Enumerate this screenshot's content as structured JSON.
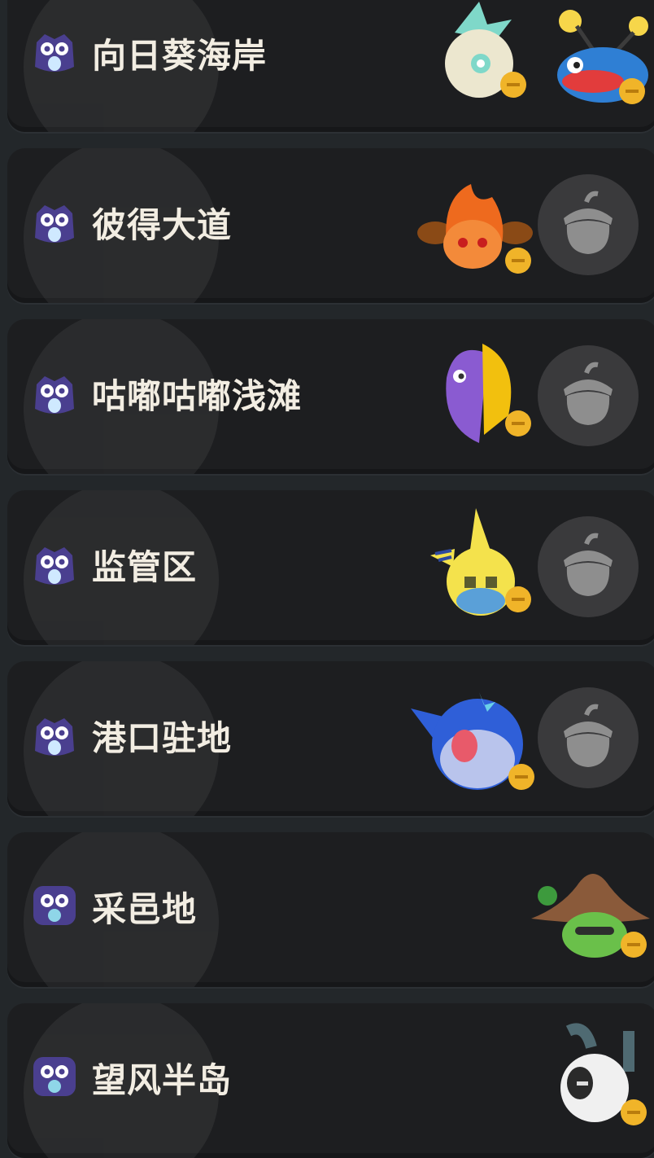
{
  "regions": [
    {
      "name": "向日葵海岸",
      "owl_style": "solid",
      "creatures": [
        "crested-shell-creature-icon",
        "antenna-fish-creature-icon"
      ],
      "locked_slot": false
    },
    {
      "name": "彼得大道",
      "owl_style": "solid",
      "creatures": [
        "flame-ram-creature-icon"
      ],
      "locked_slot": true
    },
    {
      "name": "咕嘟咕嘟浅滩",
      "owl_style": "solid",
      "creatures": [
        "toucan-creature-icon"
      ],
      "locked_slot": true
    },
    {
      "name": "监管区",
      "owl_style": "solid",
      "creatures": [
        "horned-yellow-creature-icon"
      ],
      "locked_slot": true
    },
    {
      "name": "港口驻地",
      "owl_style": "solid",
      "creatures": [
        "blue-bird-creature-icon"
      ],
      "locked_slot": true
    },
    {
      "name": "采邑地",
      "owl_style": "framed",
      "creatures": [
        "hat-frog-creature-icon"
      ],
      "locked_slot": false
    },
    {
      "name": "望风半岛",
      "owl_style": "framed",
      "creatures": [
        "robot-panda-creature-icon"
      ],
      "locked_slot": false
    }
  ],
  "colors": {
    "background": "#23272a",
    "card": "#1d1e20",
    "label": "#f2ede2",
    "owl_purple": "#4a3f8f",
    "bell_gold": "#f0b429",
    "locked_circle": "#3a3a3c"
  }
}
